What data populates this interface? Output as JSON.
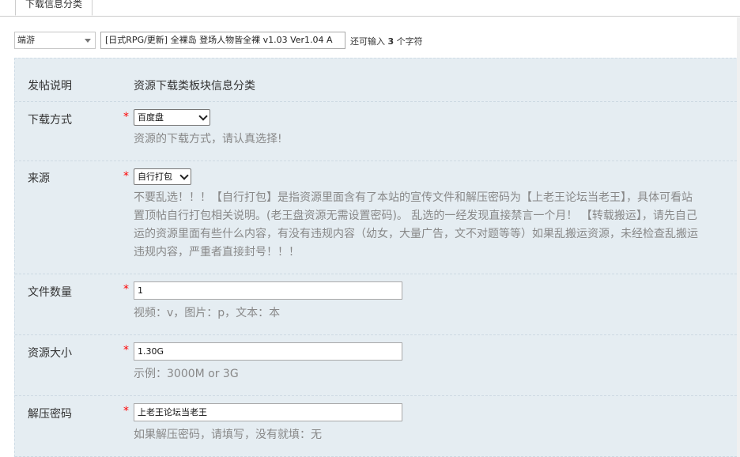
{
  "tab": {
    "label": "下载信息分类"
  },
  "subject": {
    "type_value": "端游",
    "input_value": "[日式RPG/更新] 全裸岛 登场人物皆全裸 v1.03 Ver1.04 A",
    "counter_prefix": "还可输入",
    "counter_num": "3",
    "counter_suffix": "个字符"
  },
  "form": {
    "desc": {
      "label": "发帖说明",
      "value": "资源下载类板块信息分类"
    },
    "download_method": {
      "label": "下载方式",
      "required": "*",
      "selected": "百度盘",
      "hint": "资源的下载方式，请认真选择!"
    },
    "source": {
      "label": "来源",
      "required": "*",
      "selected": "自行打包",
      "hint_lines": [
        "不要乱选！！！【自行打包】是指资源里面含有了本站的宣传文件和解压密码为【上老王论坛当老王】，具体可看站",
        "置顶帖自行打包相关说明。(老王盘资源无需设置密码)。 乱选的一经发现直接禁言一个月！ 【转载搬运】，请先自己",
        "运的资源里面有些什么内容，有没有违规内容（幼女，大量广告，文不对题等等）如果乱搬运资源，未经检查乱搬运",
        "违规内容，严重者直接封号！！！"
      ]
    },
    "file_count": {
      "label": "文件数量",
      "required": "*",
      "value": "1",
      "hint": "视频：v，图片：p，文本：本"
    },
    "size": {
      "label": "资源大小",
      "required": "*",
      "value": "1.30G",
      "hint": "示例：3000M or 3G"
    },
    "password": {
      "label": "解压密码",
      "required": "*",
      "value": "上老王论坛当老王",
      "hint": "如果解压密码，请填写，没有就填：无"
    }
  }
}
